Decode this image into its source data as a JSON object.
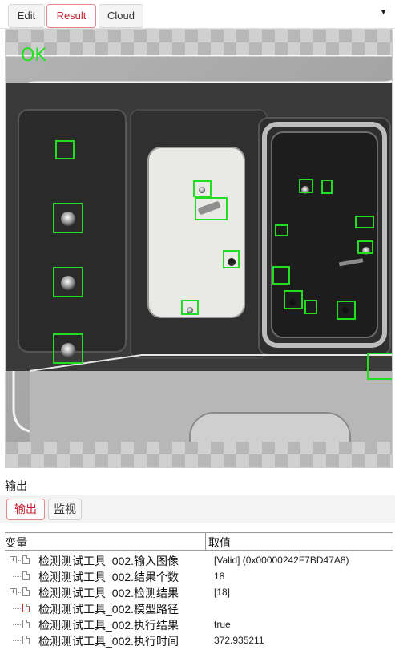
{
  "tabs": [
    {
      "label": "Edit",
      "active": false
    },
    {
      "label": "Result",
      "active": true
    },
    {
      "label": "Cloud",
      "active": false
    }
  ],
  "viewer": {
    "status_label": "OK",
    "status_color": "#20e020",
    "detection_box_color": "#22dd22"
  },
  "output_panel": {
    "title": "输出",
    "subtabs": [
      {
        "label": "输出",
        "active": true
      },
      {
        "label": "监视",
        "active": false
      }
    ],
    "table": {
      "headers": {
        "variable": "变量",
        "value": "取值"
      },
      "rows": [
        {
          "name": "检测测试工具_002.输入图像",
          "value": "[Valid] (0x00000242F7BD47A8)",
          "expandable": true
        },
        {
          "name": "检测测试工具_002.结果个数",
          "value": "18",
          "expandable": false
        },
        {
          "name": "检测测试工具_002.检测结果",
          "value": "[18]",
          "expandable": true
        },
        {
          "name": "检测测试工具_002.模型路径",
          "value": "",
          "expandable": false
        },
        {
          "name": "检测测试工具_002.执行结果",
          "value": "true",
          "expandable": false
        },
        {
          "name": "检测测试工具_002.执行时间",
          "value": "372.935211",
          "expandable": false
        }
      ]
    }
  }
}
